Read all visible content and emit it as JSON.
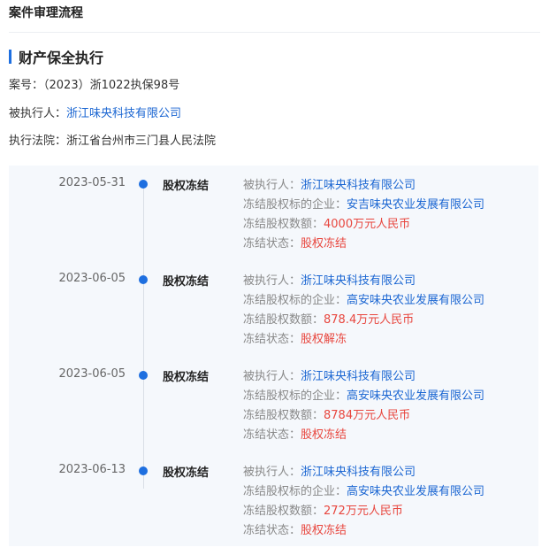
{
  "page": {
    "title": "案件审理流程"
  },
  "section": {
    "title": "财产保全执行"
  },
  "case": {
    "case_no_label": "案号：",
    "case_no": "（2023）浙1022执保98号",
    "executee_label": "被执行人：",
    "executee": "浙江味央科技有限公司",
    "court_label": "执行法院：",
    "court": "浙江省台州市三门县人民法院"
  },
  "labels": {
    "executee": "被执行人：",
    "target_company": "冻结股权标的企业：",
    "amount": "冻结股权数额：",
    "status": "冻结状态："
  },
  "timeline": [
    {
      "date": "2023-05-31",
      "type": "股权冻结",
      "executee": "浙江味央科技有限公司",
      "target": "安吉味央农业发展有限公司",
      "amount": "4000万元人民币",
      "status": "股权冻结"
    },
    {
      "date": "2023-06-05",
      "type": "股权冻结",
      "executee": "浙江味央科技有限公司",
      "target": "高安味央农业发展有限公司",
      "amount": "878.4万元人民币",
      "status": "股权解冻"
    },
    {
      "date": "2023-06-05",
      "type": "股权冻结",
      "executee": "浙江味央科技有限公司",
      "target": "高安味央农业发展有限公司",
      "amount": "8784万元人民币",
      "status": "股权冻结"
    },
    {
      "date": "2023-06-13",
      "type": "股权冻结",
      "executee": "浙江味央科技有限公司",
      "target": "高安味央农业发展有限公司",
      "amount": "272万元人民币",
      "status": "股权冻结"
    }
  ],
  "colors": {
    "accent": "#1e6fe0",
    "link": "#1b66d2",
    "red": "#e8463e",
    "timeline_bg": "#f5f8fc"
  }
}
